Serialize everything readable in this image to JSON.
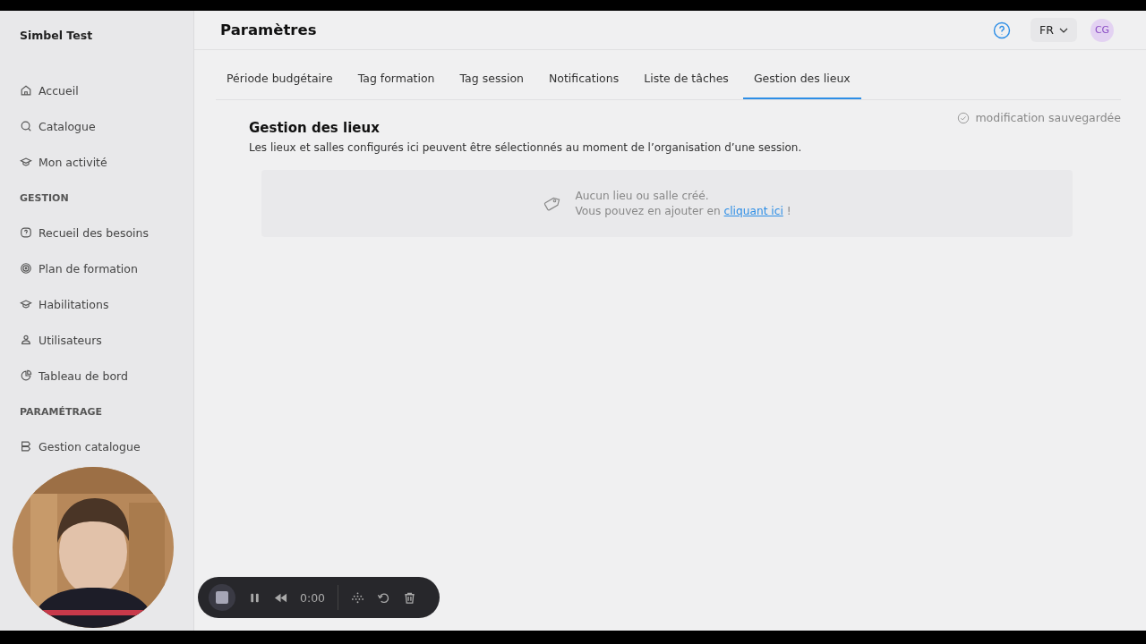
{
  "app": {
    "name": "Simbel Test"
  },
  "sidebar": {
    "sections": [
      {
        "items": [
          {
            "label": "Accueil"
          },
          {
            "label": "Catalogue"
          },
          {
            "label": "Mon activité"
          }
        ]
      },
      {
        "heading": "GESTION",
        "items": [
          {
            "label": "Recueil des besoins"
          },
          {
            "label": "Plan de formation"
          },
          {
            "label": "Habilitations"
          },
          {
            "label": "Utilisateurs"
          },
          {
            "label": "Tableau de bord"
          }
        ]
      },
      {
        "heading": "PARAMÉTRAGE",
        "items": [
          {
            "label": "Gestion catalogue"
          }
        ]
      }
    ]
  },
  "header": {
    "title": "Paramètres",
    "language": "FR",
    "avatar": "CG"
  },
  "tabs": [
    {
      "label": "Période budgétaire",
      "selected": false
    },
    {
      "label": "Tag formation",
      "selected": false
    },
    {
      "label": "Tag session",
      "selected": false
    },
    {
      "label": "Notifications",
      "selected": false
    },
    {
      "label": "Liste de tâches",
      "selected": false
    },
    {
      "label": "Gestion des lieux",
      "selected": true
    }
  ],
  "save_status": "modification sauvegardée",
  "section": {
    "title": "Gestion des lieux",
    "description": "Les lieux et salles configurés ici peuvent être sélectionnés au moment de l’organisation d’une session.",
    "empty_state": {
      "message": "Aucun lieu ou salle créé.",
      "hint": "Vous pouvez en ajouter en",
      "link": "cliquant ici",
      "hint_end": "!"
    }
  },
  "recorder": {
    "time": "0:00"
  }
}
